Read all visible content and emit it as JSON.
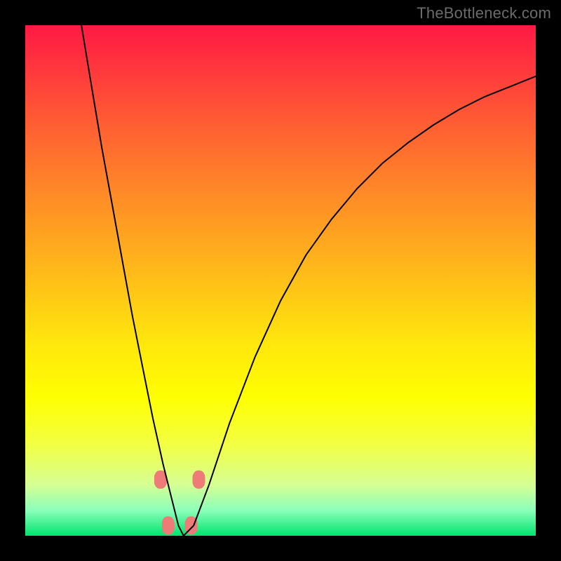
{
  "watermark": "TheBottleneck.com",
  "chart_data": {
    "type": "line",
    "title": "",
    "xlabel": "",
    "ylabel": "",
    "axes_visible": false,
    "grid": false,
    "legend": false,
    "background_gradient": [
      "#ff1944",
      "#ffe60d",
      "#00e46e"
    ],
    "xlim": [
      0,
      100
    ],
    "ylim": [
      0,
      100
    ],
    "series": [
      {
        "name": "bottleneck-curve",
        "color": "#000000",
        "x": [
          11,
          13,
          15,
          17,
          19,
          21,
          23,
          25,
          27,
          29,
          30,
          31,
          33,
          36,
          40,
          45,
          50,
          55,
          60,
          65,
          70,
          75,
          80,
          85,
          90,
          95,
          100
        ],
        "y": [
          100,
          88,
          76,
          65,
          54,
          43,
          33,
          23,
          14,
          6,
          2,
          0,
          2,
          10,
          22,
          35,
          46,
          55,
          62,
          68,
          73,
          77,
          80.5,
          83.5,
          86,
          88,
          90
        ]
      }
    ],
    "markers": [
      {
        "shape": "rounded",
        "color": "#ed7b78",
        "x": 26.5,
        "y": 11
      },
      {
        "shape": "rounded",
        "color": "#ed7b78",
        "x": 34.0,
        "y": 11
      },
      {
        "shape": "rounded",
        "color": "#ed7b78",
        "x": 28.0,
        "y": 2
      },
      {
        "shape": "rounded",
        "color": "#ed7b78",
        "x": 32.5,
        "y": 2
      }
    ]
  }
}
